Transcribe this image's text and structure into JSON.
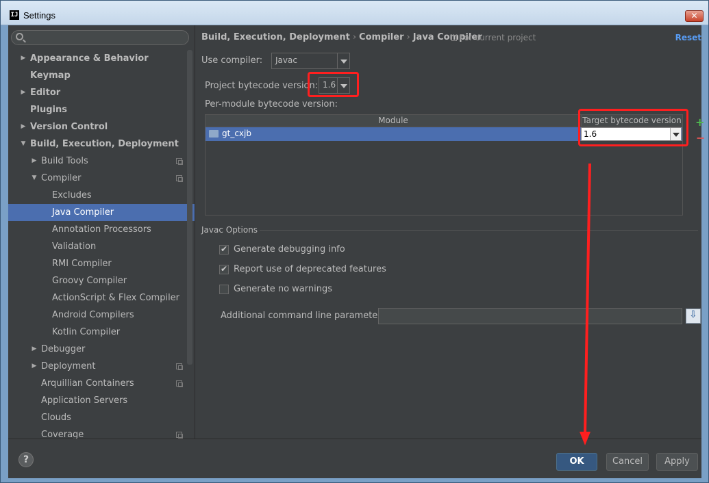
{
  "window": {
    "title": "Settings",
    "app_icon": "IJ",
    "close_label": "✕"
  },
  "sidebar": {
    "search_placeholder": "",
    "items": [
      {
        "label": "Appearance & Behavior",
        "level": 0,
        "bold": true,
        "arrow": "right"
      },
      {
        "label": "Keymap",
        "level": 0,
        "bold": true,
        "arrow": "none"
      },
      {
        "label": "Editor",
        "level": 0,
        "bold": true,
        "arrow": "right"
      },
      {
        "label": "Plugins",
        "level": 0,
        "bold": true,
        "arrow": "none"
      },
      {
        "label": "Version Control",
        "level": 0,
        "bold": true,
        "arrow": "right"
      },
      {
        "label": "Build, Execution, Deployment",
        "level": 0,
        "bold": true,
        "arrow": "down"
      },
      {
        "label": "Build Tools",
        "level": 1,
        "arrow": "right",
        "copy_icon": true
      },
      {
        "label": "Compiler",
        "level": 1,
        "arrow": "down",
        "copy_icon": true
      },
      {
        "label": "Excludes",
        "level": 2,
        "arrow": "none"
      },
      {
        "label": "Java Compiler",
        "level": 2,
        "arrow": "none",
        "selected": true
      },
      {
        "label": "Annotation Processors",
        "level": 2,
        "arrow": "none"
      },
      {
        "label": "Validation",
        "level": 2,
        "arrow": "none"
      },
      {
        "label": "RMI Compiler",
        "level": 2,
        "arrow": "none"
      },
      {
        "label": "Groovy Compiler",
        "level": 2,
        "arrow": "none"
      },
      {
        "label": "ActionScript & Flex Compiler",
        "level": 2,
        "arrow": "none"
      },
      {
        "label": "Android Compilers",
        "level": 2,
        "arrow": "none"
      },
      {
        "label": "Kotlin Compiler",
        "level": 2,
        "arrow": "none"
      },
      {
        "label": "Debugger",
        "level": 1,
        "arrow": "right"
      },
      {
        "label": "Deployment",
        "level": 1,
        "arrow": "right",
        "copy_icon": true
      },
      {
        "label": "Arquillian Containers",
        "level": 1,
        "arrow": "none",
        "copy_icon": true
      },
      {
        "label": "Application Servers",
        "level": 1,
        "arrow": "none"
      },
      {
        "label": "Clouds",
        "level": 1,
        "arrow": "none"
      },
      {
        "label": "Coverage",
        "level": 1,
        "arrow": "none",
        "copy_icon": true
      }
    ]
  },
  "breadcrumb": {
    "parts": [
      "Build, Execution, Deployment",
      "Compiler",
      "Java Compiler"
    ],
    "separator": "›",
    "note": "For current project",
    "reset": "Reset"
  },
  "compiler": {
    "use_compiler_label": "Use compiler:",
    "use_compiler_value": "Javac",
    "project_bytecode_label": "Project bytecode version:",
    "project_bytecode_value": "1.6",
    "per_module_label": "Per-module bytecode version:"
  },
  "module_table": {
    "columns": [
      "Module",
      "Target bytecode version"
    ],
    "rows": [
      {
        "module": "gt_cxjb",
        "target": "1.6"
      }
    ],
    "add_label": "+",
    "remove_label": "−"
  },
  "javac_options": {
    "group_label": "Javac Options",
    "checkboxes": [
      {
        "label": "Generate debugging info",
        "checked": true
      },
      {
        "label": "Report use of deprecated features",
        "checked": true
      },
      {
        "label": "Generate no warnings",
        "checked": false
      }
    ],
    "additional_params_label": "Additional command line parameters:",
    "additional_params_value": ""
  },
  "footer": {
    "help": "?",
    "ok": "OK",
    "cancel": "Cancel",
    "apply": "Apply"
  },
  "colors": {
    "panel_bg": "#3c3f41",
    "selection": "#4b6eaf",
    "link": "#589df6",
    "annotation_red": "#ff1f1f",
    "default_button": "#365880"
  }
}
